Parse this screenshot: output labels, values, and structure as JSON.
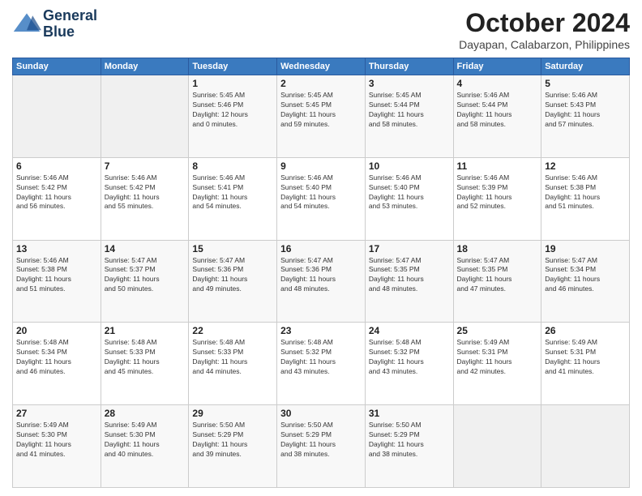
{
  "logo": {
    "line1": "General",
    "line2": "Blue"
  },
  "title": "October 2024",
  "location": "Dayapan, Calabarzon, Philippines",
  "weekdays": [
    "Sunday",
    "Monday",
    "Tuesday",
    "Wednesday",
    "Thursday",
    "Friday",
    "Saturday"
  ],
  "weeks": [
    [
      {
        "day": "",
        "info": ""
      },
      {
        "day": "",
        "info": ""
      },
      {
        "day": "1",
        "info": "Sunrise: 5:45 AM\nSunset: 5:46 PM\nDaylight: 12 hours\nand 0 minutes."
      },
      {
        "day": "2",
        "info": "Sunrise: 5:45 AM\nSunset: 5:45 PM\nDaylight: 11 hours\nand 59 minutes."
      },
      {
        "day": "3",
        "info": "Sunrise: 5:45 AM\nSunset: 5:44 PM\nDaylight: 11 hours\nand 58 minutes."
      },
      {
        "day": "4",
        "info": "Sunrise: 5:46 AM\nSunset: 5:44 PM\nDaylight: 11 hours\nand 58 minutes."
      },
      {
        "day": "5",
        "info": "Sunrise: 5:46 AM\nSunset: 5:43 PM\nDaylight: 11 hours\nand 57 minutes."
      }
    ],
    [
      {
        "day": "6",
        "info": "Sunrise: 5:46 AM\nSunset: 5:42 PM\nDaylight: 11 hours\nand 56 minutes."
      },
      {
        "day": "7",
        "info": "Sunrise: 5:46 AM\nSunset: 5:42 PM\nDaylight: 11 hours\nand 55 minutes."
      },
      {
        "day": "8",
        "info": "Sunrise: 5:46 AM\nSunset: 5:41 PM\nDaylight: 11 hours\nand 54 minutes."
      },
      {
        "day": "9",
        "info": "Sunrise: 5:46 AM\nSunset: 5:40 PM\nDaylight: 11 hours\nand 54 minutes."
      },
      {
        "day": "10",
        "info": "Sunrise: 5:46 AM\nSunset: 5:40 PM\nDaylight: 11 hours\nand 53 minutes."
      },
      {
        "day": "11",
        "info": "Sunrise: 5:46 AM\nSunset: 5:39 PM\nDaylight: 11 hours\nand 52 minutes."
      },
      {
        "day": "12",
        "info": "Sunrise: 5:46 AM\nSunset: 5:38 PM\nDaylight: 11 hours\nand 51 minutes."
      }
    ],
    [
      {
        "day": "13",
        "info": "Sunrise: 5:46 AM\nSunset: 5:38 PM\nDaylight: 11 hours\nand 51 minutes."
      },
      {
        "day": "14",
        "info": "Sunrise: 5:47 AM\nSunset: 5:37 PM\nDaylight: 11 hours\nand 50 minutes."
      },
      {
        "day": "15",
        "info": "Sunrise: 5:47 AM\nSunset: 5:36 PM\nDaylight: 11 hours\nand 49 minutes."
      },
      {
        "day": "16",
        "info": "Sunrise: 5:47 AM\nSunset: 5:36 PM\nDaylight: 11 hours\nand 48 minutes."
      },
      {
        "day": "17",
        "info": "Sunrise: 5:47 AM\nSunset: 5:35 PM\nDaylight: 11 hours\nand 48 minutes."
      },
      {
        "day": "18",
        "info": "Sunrise: 5:47 AM\nSunset: 5:35 PM\nDaylight: 11 hours\nand 47 minutes."
      },
      {
        "day": "19",
        "info": "Sunrise: 5:47 AM\nSunset: 5:34 PM\nDaylight: 11 hours\nand 46 minutes."
      }
    ],
    [
      {
        "day": "20",
        "info": "Sunrise: 5:48 AM\nSunset: 5:34 PM\nDaylight: 11 hours\nand 46 minutes."
      },
      {
        "day": "21",
        "info": "Sunrise: 5:48 AM\nSunset: 5:33 PM\nDaylight: 11 hours\nand 45 minutes."
      },
      {
        "day": "22",
        "info": "Sunrise: 5:48 AM\nSunset: 5:33 PM\nDaylight: 11 hours\nand 44 minutes."
      },
      {
        "day": "23",
        "info": "Sunrise: 5:48 AM\nSunset: 5:32 PM\nDaylight: 11 hours\nand 43 minutes."
      },
      {
        "day": "24",
        "info": "Sunrise: 5:48 AM\nSunset: 5:32 PM\nDaylight: 11 hours\nand 43 minutes."
      },
      {
        "day": "25",
        "info": "Sunrise: 5:49 AM\nSunset: 5:31 PM\nDaylight: 11 hours\nand 42 minutes."
      },
      {
        "day": "26",
        "info": "Sunrise: 5:49 AM\nSunset: 5:31 PM\nDaylight: 11 hours\nand 41 minutes."
      }
    ],
    [
      {
        "day": "27",
        "info": "Sunrise: 5:49 AM\nSunset: 5:30 PM\nDaylight: 11 hours\nand 41 minutes."
      },
      {
        "day": "28",
        "info": "Sunrise: 5:49 AM\nSunset: 5:30 PM\nDaylight: 11 hours\nand 40 minutes."
      },
      {
        "day": "29",
        "info": "Sunrise: 5:50 AM\nSunset: 5:29 PM\nDaylight: 11 hours\nand 39 minutes."
      },
      {
        "day": "30",
        "info": "Sunrise: 5:50 AM\nSunset: 5:29 PM\nDaylight: 11 hours\nand 38 minutes."
      },
      {
        "day": "31",
        "info": "Sunrise: 5:50 AM\nSunset: 5:29 PM\nDaylight: 11 hours\nand 38 minutes."
      },
      {
        "day": "",
        "info": ""
      },
      {
        "day": "",
        "info": ""
      }
    ]
  ]
}
